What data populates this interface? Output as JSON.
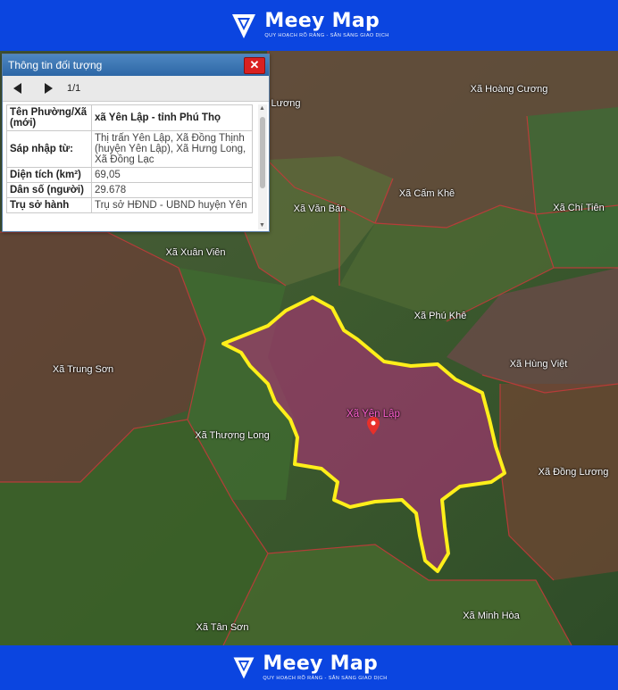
{
  "brand": {
    "name": "Meey Map",
    "tagline": "QUY HOẠCH RÕ RÀNG - SẴN SÀNG GIAO DỊCH"
  },
  "panel": {
    "title": "Thông tin đối tượng",
    "close_label": "✕",
    "prev_icon": "prev-arrow-icon",
    "next_icon": "next-arrow-icon",
    "page_indicator": "1/1",
    "rows": [
      {
        "key": "Tên Phường/Xã (mới)",
        "value": "xã Yên Lập - tỉnh Phú Thọ"
      },
      {
        "key": "Sáp nhập từ:",
        "value": "Thị trấn Yên Lập, Xã Đồng Thịnh (huyện Yên Lập), Xã Hưng Long, Xã Đồng Lạc"
      },
      {
        "key": "Diện tích (km²)",
        "value": "69,05"
      },
      {
        "key": "Dân số (người)",
        "value": "29.678"
      },
      {
        "key": "Trụ sở hành",
        "value": "Trụ sở HĐND - UBND huyện Yên"
      }
    ]
  },
  "map": {
    "highlight_color": "#ffef1a",
    "selected_fill": "#b0307a",
    "labels": [
      "Lương",
      "Xã Hoàng Cương",
      "Xã Cấm Khê",
      "Xã Chí Tiên",
      "Xã Văn Bán",
      "Xã Xuân Viên",
      "Xã Phú Khê",
      "Xã Trung Sơn",
      "Xã Hùng Việt",
      "Xã Yên Lập",
      "Xã Thượng Long",
      "Xã Đồng Lương",
      "Xã Tân Sơn",
      "Xã Minh Hòa"
    ]
  }
}
